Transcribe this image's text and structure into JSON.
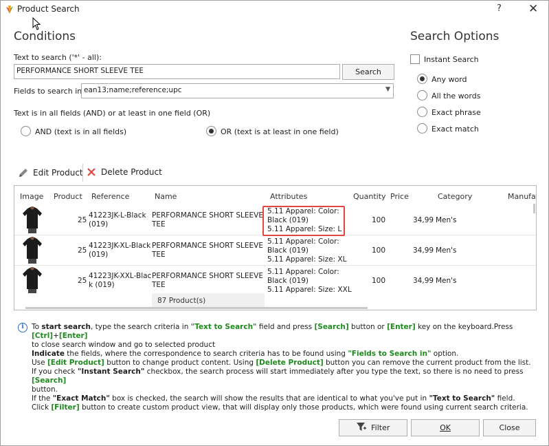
{
  "window": {
    "title": "Product Search",
    "help_label": "?",
    "close_label": "✕"
  },
  "conditions": {
    "heading": "Conditions",
    "text_label": "Text to search ('*' - all):",
    "text_value": "PERFORMANCE SHORT SLEEVE TEE",
    "search_button": "Search",
    "fields_label": "Fields to search in",
    "fields_value": "ean13;name;reference;upc",
    "mode_label": "Text is in all fields (AND) or at least in one field (OR)",
    "and_label": "AND (text is in all fields)",
    "or_label": "OR (text is at least in one field)",
    "selected_mode": "OR"
  },
  "search_options": {
    "heading": "Search Options",
    "instant_search_label": "Instant Search",
    "instant_search_checked": false,
    "options": [
      "Any word",
      "All the words",
      "Exact phrase",
      "Exact match"
    ],
    "selected": "Any word"
  },
  "toolbar": {
    "edit_label": "Edit Product",
    "delete_label": "Delete Product"
  },
  "grid": {
    "columns": [
      "Image",
      "Product",
      "Reference",
      "Name",
      "Attributes",
      "Quantity",
      "Price",
      "Category",
      "Manufa"
    ],
    "rows": [
      {
        "product": "25",
        "reference_1": "41223JK-L-Black",
        "reference_2": "(019)",
        "name_1": "PERFORMANCE SHORT SLEEVE",
        "name_2": "TEE",
        "attr_1": "5.11 Apparel: Color:",
        "attr_2": "Black (019)",
        "attr_3": "5.11 Apparel: Size: L",
        "quantity": "100",
        "price": "34,99",
        "category": "Men's"
      },
      {
        "product": "25",
        "reference_1": "41223JK-XL-Black",
        "reference_2": "(019)",
        "name_1": "PERFORMANCE SHORT SLEEVE",
        "name_2": "TEE",
        "attr_1": "5.11 Apparel: Color:",
        "attr_2": "Black (019)",
        "attr_3": "5.11 Apparel: Size: XL",
        "quantity": "100",
        "price": "34,99",
        "category": "Men's"
      },
      {
        "product": "25",
        "reference_1": "41223JK-XXL-Blac",
        "reference_2": "k (019)",
        "name_1": "PERFORMANCE SHORT SLEEVE",
        "name_2": "TEE",
        "attr_1": "5.11 Apparel: Color:",
        "attr_2": "Black (019)",
        "attr_3": "5.11 Apparel: Size: XXL",
        "quantity": "100",
        "price": "34,99",
        "category": "Men's"
      }
    ],
    "product_count": "87 Product(s)"
  },
  "info": {
    "line1": {
      "t1": "To ",
      "b1": "start search",
      "t2": ", type the search criteria in ",
      "k1": "\"Text to Search\"",
      "t3": " field and press ",
      "k2": "[Search]",
      "t4": " button or ",
      "k3": "[Enter]",
      "t5": " key on the keyboard.Press ",
      "k4": "[Ctrl]",
      "t6": "+",
      "k5": "[Enter]"
    },
    "line2": "to close search window and go to selected product",
    "line3": {
      "b1": "Indicate",
      "t1": " the fields, where the correspondence to search criteria has to be found using ",
      "k1": "\"Fields to Search in\"",
      "t2": " option."
    },
    "line4": {
      "t1": "Use ",
      "k1": "[Edit Product]",
      "t2": " button to change product content. Using ",
      "k2": "[Delete Product]",
      "t3": " button you can remove the current product from the list."
    },
    "line5": {
      "t1": "If you check ",
      "b1": "\"Instant Search\"",
      "t2": " checkbox, the search process will start immediately after you type the text, so there is no need to press ",
      "k1": "[Search]"
    },
    "line6": "button.",
    "line7": {
      "t1": "If the ",
      "b1": "\"Exact Match\"",
      "t2": " box is checked, the search will show the results that are identical to what you've put in ",
      "b2": "\"Text to Search\"",
      "t3": " field."
    },
    "line8": {
      "t1": "Click ",
      "k1": "[Filter]",
      "t2": " button to create custom product view, that will display only those products, which were found using current search criteria."
    }
  },
  "buttons": {
    "filter": "Filter",
    "ok": "OK",
    "close": "Close"
  }
}
